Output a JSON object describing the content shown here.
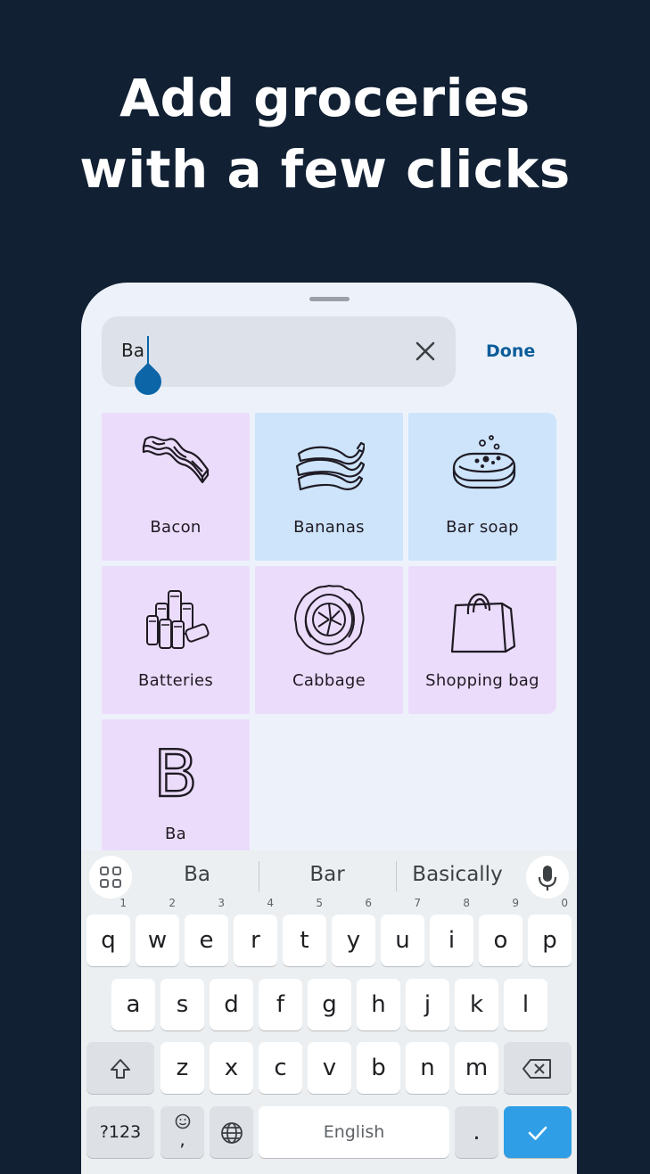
{
  "headline": {
    "line1": "Add groceries",
    "line2": "with a few clicks"
  },
  "search": {
    "value": "Ba",
    "clear_icon": "close-icon",
    "done_label": "Done"
  },
  "items": [
    {
      "label": "Bacon",
      "icon": "bacon-icon",
      "color": "#ecdcfb"
    },
    {
      "label": "Bananas",
      "icon": "bananas-icon",
      "color": "#cde4fb"
    },
    {
      "label": "Bar soap",
      "icon": "soap-icon",
      "color": "#cde4fb"
    },
    {
      "label": "Batteries",
      "icon": "batteries-icon",
      "color": "#ecdcfb"
    },
    {
      "label": "Cabbage",
      "icon": "cabbage-icon",
      "color": "#ecdcfb"
    },
    {
      "label": "Shopping bag",
      "icon": "shopping-bag-icon",
      "color": "#ecdcfb"
    },
    {
      "label": "Ba",
      "icon": "letter-b-icon",
      "glyph": "B",
      "color": "#ecdcfb"
    }
  ],
  "keyboard": {
    "suggestions": [
      "Ba",
      "Bar",
      "Basically"
    ],
    "row1": [
      {
        "k": "q",
        "h": "1"
      },
      {
        "k": "w",
        "h": "2"
      },
      {
        "k": "e",
        "h": "3"
      },
      {
        "k": "r",
        "h": "4"
      },
      {
        "k": "t",
        "h": "5"
      },
      {
        "k": "y",
        "h": "6"
      },
      {
        "k": "u",
        "h": "7"
      },
      {
        "k": "i",
        "h": "8"
      },
      {
        "k": "o",
        "h": "9"
      },
      {
        "k": "p",
        "h": "0"
      }
    ],
    "row2": [
      "a",
      "s",
      "d",
      "f",
      "g",
      "h",
      "j",
      "k",
      "l"
    ],
    "row3": [
      "z",
      "x",
      "c",
      "v",
      "b",
      "n",
      "m"
    ],
    "symbols_label": "?123",
    "comma_label": ",",
    "space_label": "English",
    "period_label": ".",
    "enter_color": "#2f9ee6"
  }
}
